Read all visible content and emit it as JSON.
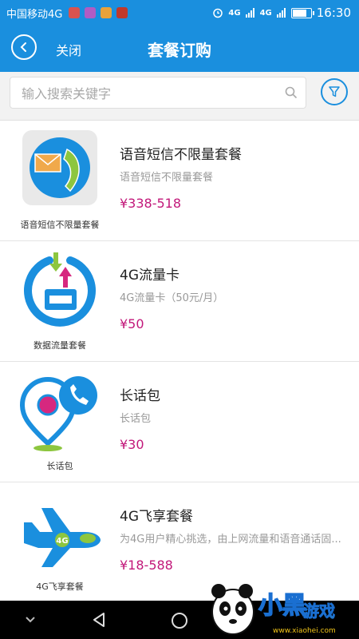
{
  "status_bar": {
    "carrier": "中国移动4G",
    "network_1": "4G",
    "network_2": "4G",
    "time": "16:30",
    "app_icon_colors": [
      "#d9534f",
      "#b05cc4",
      "#e8a23a",
      "#c0392b"
    ]
  },
  "header": {
    "back_icon": "chevron-left-icon",
    "close_label": "关闭",
    "title": "套餐订购"
  },
  "search": {
    "placeholder": "输入搜索关键字",
    "value": ""
  },
  "packages": [
    {
      "thumb_caption": "语音短信不限量套餐",
      "name": "语音短信不限量套餐",
      "description": "语音短信不限量套餐",
      "price": "¥338-518",
      "icon": "phone-mail-icon"
    },
    {
      "thumb_caption": "数据流量套餐",
      "name": "4G流量卡",
      "description": "4G流量卡（50元/月）",
      "price": "¥50",
      "icon": "data-traffic-icon"
    },
    {
      "thumb_caption": "长话包",
      "name": "长话包",
      "description": "长话包",
      "price": "¥30",
      "icon": "location-phone-icon"
    },
    {
      "thumb_caption": "4G飞享套餐",
      "name": "4G飞享套餐",
      "description": "为4G用户精心挑选，由上网流量和语音通话固...",
      "price": "¥18-588",
      "icon": "airplane-4g-icon"
    }
  ],
  "colors": {
    "primary": "#1a8fde",
    "price": "#c2187a",
    "lime": "#8dc63f"
  },
  "watermark": {
    "brand": "小黑游戏",
    "url": "www.xiaohei.com"
  }
}
